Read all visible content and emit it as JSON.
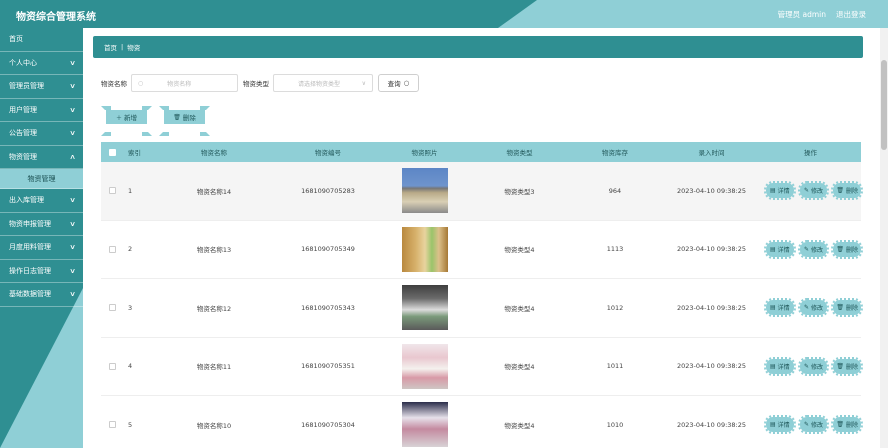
{
  "header": {
    "title": "物资综合管理系统",
    "admin": "管理员 admin",
    "logout": "退出登录"
  },
  "sidebar": {
    "items": [
      {
        "label": "首页",
        "chevron": false
      },
      {
        "label": "个人中心",
        "chevron": true
      },
      {
        "label": "管理员管理",
        "chevron": true
      },
      {
        "label": "用户管理",
        "chevron": true
      },
      {
        "label": "公告管理",
        "chevron": true
      },
      {
        "label": "物资管理",
        "chevron": true,
        "expanded": true
      },
      {
        "label": "物资管理",
        "sub": true,
        "active": true
      },
      {
        "label": "出入库管理",
        "chevron": true
      },
      {
        "label": "物资申报管理",
        "chevron": true
      },
      {
        "label": "月度用料管理",
        "chevron": true
      },
      {
        "label": "操作日志管理",
        "chevron": true
      },
      {
        "label": "基础数据管理",
        "chevron": true
      }
    ]
  },
  "breadcrumb": {
    "home": "首页",
    "sep": "|",
    "current": "物资"
  },
  "search": {
    "name_label": "物资名称",
    "name_placeholder": "物资名称",
    "type_label": "物资类型",
    "type_placeholder": "请选择物资类型",
    "query_button": "查询"
  },
  "actions": {
    "add": "新增",
    "delete": "删除"
  },
  "table": {
    "headers": {
      "index": "索引",
      "name": "物资名称",
      "code": "物资编号",
      "photo": "物资照片",
      "type": "物资类型",
      "stock": "物资库存",
      "time": "录入时间",
      "ops": "操作"
    },
    "rows": [
      {
        "index": "1",
        "name": "物资名称14",
        "code": "1681090705283",
        "type": "物资类型3",
        "stock": "964",
        "time": "2023-04-10 09:38:25"
      },
      {
        "index": "2",
        "name": "物资名称13",
        "code": "1681090705349",
        "type": "物资类型4",
        "stock": "1113",
        "time": "2023-04-10 09:38:25"
      },
      {
        "index": "3",
        "name": "物资名称12",
        "code": "1681090705343",
        "type": "物资类型4",
        "stock": "1012",
        "time": "2023-04-10 09:38:25"
      },
      {
        "index": "4",
        "name": "物资名称11",
        "code": "1681090705351",
        "type": "物资类型4",
        "stock": "1011",
        "time": "2023-04-10 09:38:25"
      },
      {
        "index": "5",
        "name": "物资名称10",
        "code": "1681090705304",
        "type": "物资类型4",
        "stock": "1010",
        "time": "2023-04-10 09:38:25"
      }
    ],
    "op_labels": {
      "detail": "详情",
      "edit": "修改",
      "delete": "删除"
    }
  },
  "colors": {
    "primary": "#2f8f92",
    "light": "#8fcfd6"
  }
}
